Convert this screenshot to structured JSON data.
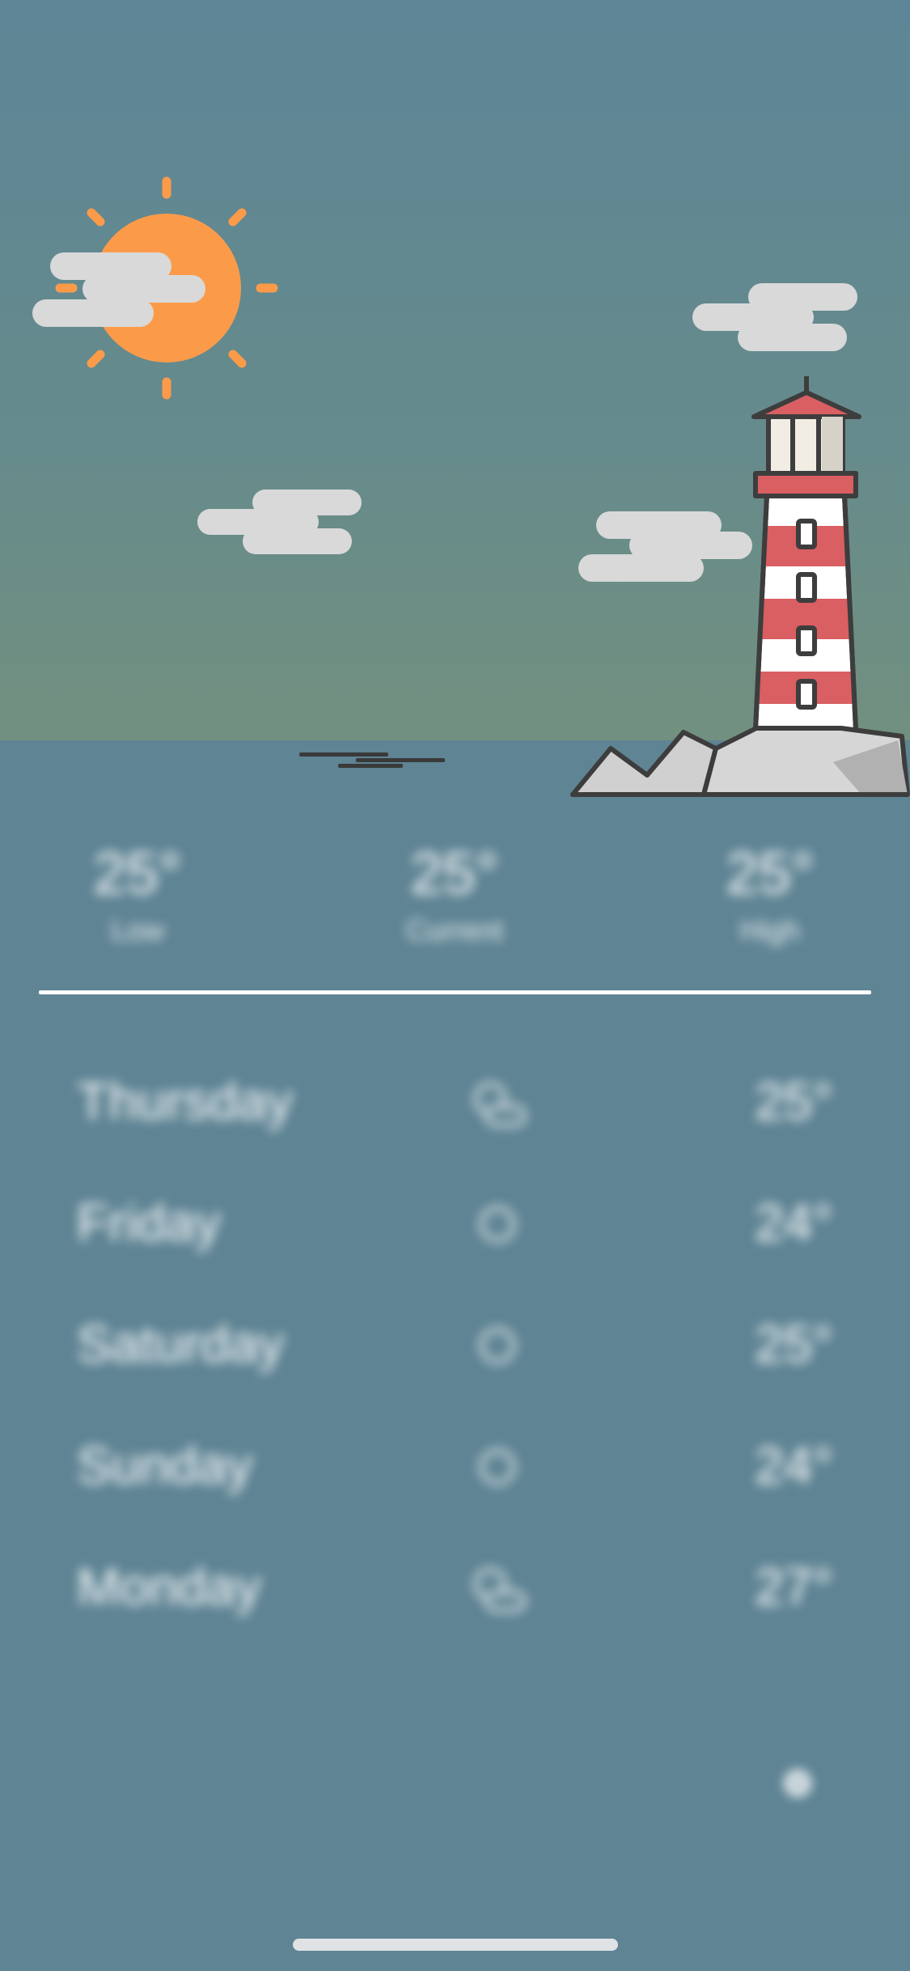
{
  "scene": {
    "sky_top_color": "#5d8596",
    "sky_horizon_color": "#6f8b7f",
    "sea_color": "#5f8494",
    "sun_color": "#fb9b4a",
    "cloud_color": "#d9d9d9",
    "lighthouse_stripe_color": "#d95f63",
    "rock_color": "#d0d0d0"
  },
  "current": {
    "stats": [
      {
        "value": "25°",
        "label": "Low"
      },
      {
        "value": "25°",
        "label": "Current"
      },
      {
        "value": "25°",
        "label": "High"
      }
    ]
  },
  "forecast": [
    {
      "day": "Thursday",
      "icon": "partly-cloudy-icon",
      "temp": "25°"
    },
    {
      "day": "Friday",
      "icon": "sun-icon",
      "temp": "24°"
    },
    {
      "day": "Saturday",
      "icon": "sun-icon",
      "temp": "25°"
    },
    {
      "day": "Sunday",
      "icon": "sun-icon",
      "temp": "24°"
    },
    {
      "day": "Monday",
      "icon": "partly-cloudy-icon",
      "temp": "27°"
    }
  ],
  "footer": {
    "icon": "settings-icon"
  }
}
